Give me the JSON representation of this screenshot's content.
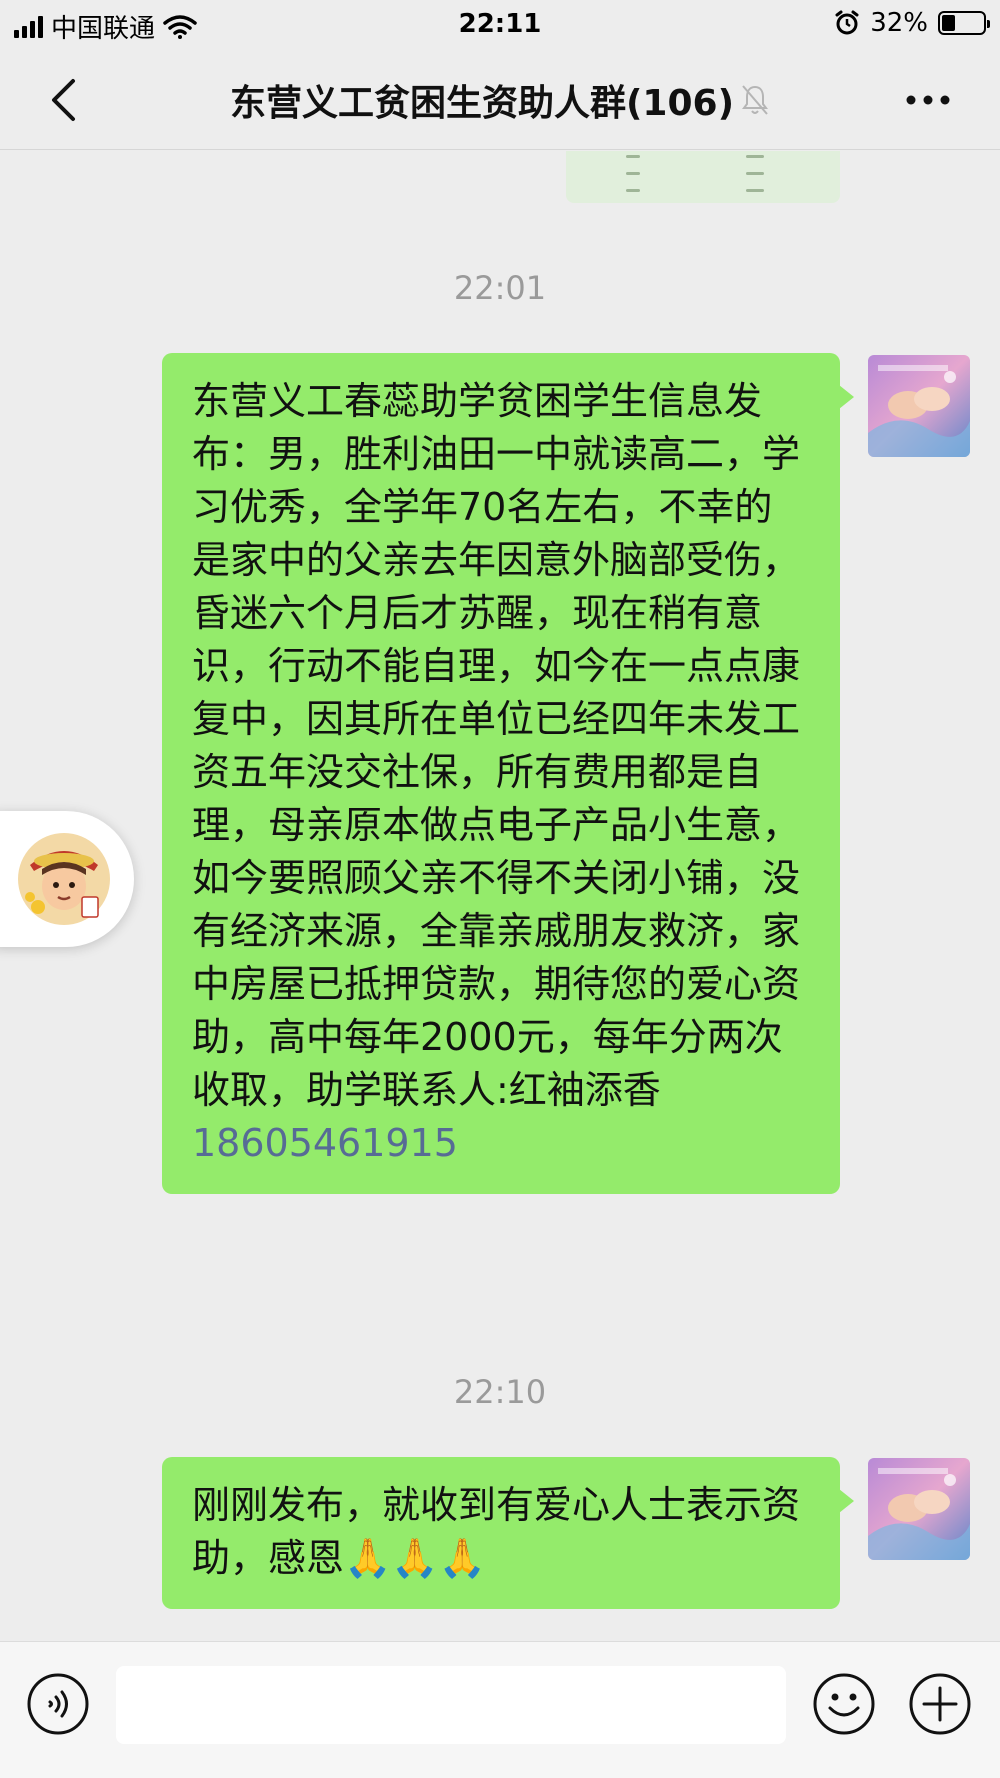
{
  "status_bar": {
    "carrier": "中国联通",
    "time": "22:11",
    "battery_percent_label": "32%",
    "battery_level": 0.32
  },
  "header": {
    "title": "东营义工贫困生资助人群(106)",
    "muted": true
  },
  "messages": [
    {
      "timestamp": "22:01",
      "text": "东营义工春蕊助学贫困学生信息发布：男，胜利油田一中就读高二，学习优秀，全学年70名左右，不幸的是家中的父亲去年因意外脑部受伤，昏迷六个月后才苏醒，现在稍有意识，行动不能自理，如今在一点点康复中，因其所在单位已经四年未发工资五年没交社保，所有费用都是自理，母亲原本做点电子产品小生意，如今要照顾父亲不得不关闭小铺，没有经济来源，全靠亲戚朋友救济，家中房屋已抵押贷款，期待您的爱心资助，高中每年2000元，每年分两次收取，助学联系人:红袖添香",
      "phone": "18605461915"
    },
    {
      "timestamp": "22:10",
      "text": "刚刚发布，就收到有爱心人士表示资助，感恩🙏🙏🙏"
    }
  ],
  "input_bar": {
    "placeholder": "",
    "icons": [
      "voice-icon",
      "emoji-icon",
      "plus-icon"
    ]
  },
  "colors": {
    "background": "#ededed",
    "bubble_green": "#94eb6b",
    "link": "#576b95",
    "timestamp": "#9a9a9a"
  }
}
